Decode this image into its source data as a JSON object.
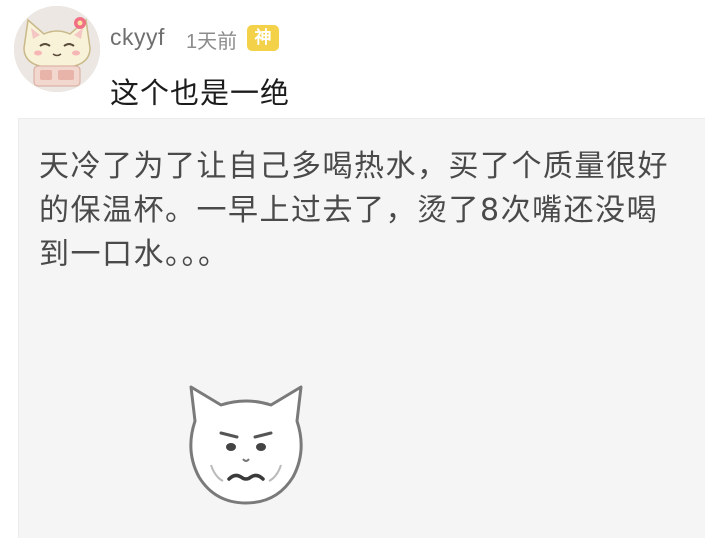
{
  "comment": {
    "username": "ckyyf",
    "time": "1天前",
    "badge": "神",
    "text": "这个也是一绝",
    "avatar_icon": "cartoon-cat-avatar"
  },
  "meme": {
    "lines": [
      "天冷了为了让自己多喝热水，买了个质量很好",
      "的保温杯。一早上过去了，烫了8次嘴还没喝",
      "到一口水。。。"
    ],
    "face_icon": "sad-cat-face-sticker"
  },
  "colors": {
    "badge": "#f3d24a",
    "username": "#6f6f6f",
    "meme_background": "#f5f5f5",
    "meme_text": "#4a4a4a"
  }
}
